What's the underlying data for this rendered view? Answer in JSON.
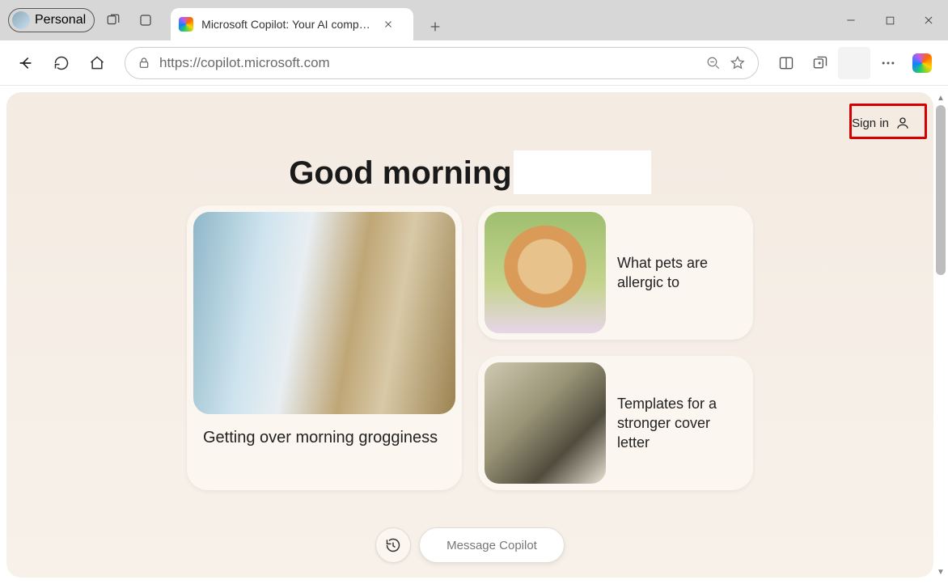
{
  "window": {
    "profile_label": "Personal",
    "tab_title": "Microsoft Copilot: Your AI compan",
    "minimize_icon": "minimize-icon",
    "maximize_icon": "maximize-icon",
    "close_icon": "close-icon"
  },
  "toolbar": {
    "url": "https://copilot.microsoft.com"
  },
  "page": {
    "signin_label": "Sign in",
    "greeting": "Good morning",
    "cards": {
      "large": {
        "caption": "Getting over morning grogginess"
      },
      "small1": {
        "caption": "What pets are allergic to"
      },
      "small2": {
        "caption": "Templates for a stronger cover letter"
      }
    },
    "compose_placeholder": "Message Copilot"
  }
}
